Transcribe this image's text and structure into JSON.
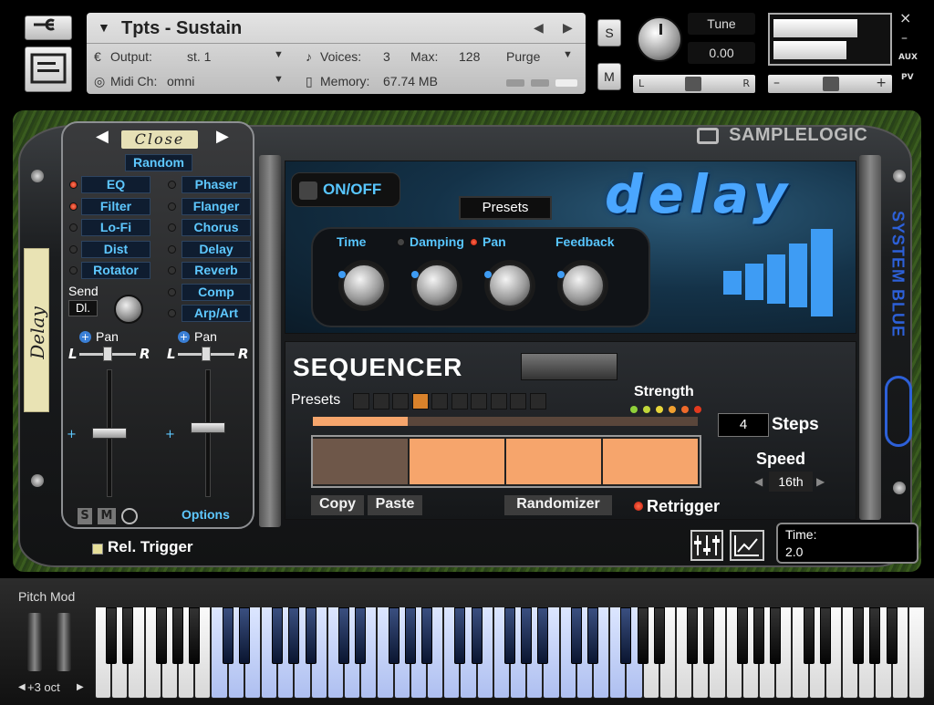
{
  "header": {
    "instrument_name": "Tpts - Sustain",
    "output_label": "Output:",
    "output_value": "st. 1",
    "voices_label": "Voices:",
    "voices_value": "3",
    "max_label": "Max:",
    "max_value": "128",
    "purge_label": "Purge",
    "midi_label": "Midi Ch:",
    "midi_value": "omni",
    "memory_label": "Memory:",
    "memory_value": "67.74 MB",
    "solo_label": "S",
    "mute_label": "M",
    "tune_label": "Tune",
    "tune_value": "0.00",
    "pan_left": "L",
    "pan_right": "R",
    "aux_label": "AUX",
    "pv_label": "PV",
    "close_glyph": "×",
    "minimize_glyph": "–",
    "minus_glyph": "–",
    "plus_glyph": "+"
  },
  "brand": "SAMPLELOGIC",
  "side_label": "Delay",
  "side_brand": "SYSTEM BLUE",
  "fx_panel": {
    "close_label": "Close",
    "random_label": "Random",
    "left_column": [
      {
        "label": "EQ",
        "active": true
      },
      {
        "label": "Filter",
        "active": true
      },
      {
        "label": "Lo-Fi",
        "active": false
      },
      {
        "label": "Dist",
        "active": false
      },
      {
        "label": "Rotator",
        "active": false
      }
    ],
    "right_column": [
      {
        "label": "Phaser",
        "active": false
      },
      {
        "label": "Flanger",
        "active": false
      },
      {
        "label": "Chorus",
        "active": false
      },
      {
        "label": "Delay",
        "active": false
      },
      {
        "label": "Reverb",
        "active": false
      },
      {
        "label": "Comp",
        "active": false
      },
      {
        "label": "Arp/Art",
        "active": false
      }
    ],
    "send_label": "Send",
    "send_value": "Dl.",
    "pan_label": "Pan",
    "pan_l": "L",
    "pan_r": "R",
    "smo_s": "S",
    "smo_m": "M",
    "options_label": "Options"
  },
  "delay": {
    "title": "delay",
    "onoff_label": "ON/OFF",
    "presets_label": "Presets",
    "knobs": [
      {
        "label": "Time",
        "led": false
      },
      {
        "label": "Damping",
        "led": false
      },
      {
        "label": "Pan",
        "led": true
      },
      {
        "label": "Feedback",
        "led": false
      }
    ]
  },
  "sequencer": {
    "title": "SEQUENCER",
    "presets_label": "Presets",
    "preset_slots": 10,
    "active_preset_index": 3,
    "strength_label": "Strength",
    "steps_value": "4",
    "steps_label": "Steps",
    "speed_label": "Speed",
    "speed_value": "16th",
    "step_levels": [
      0,
      1,
      1,
      1
    ],
    "copy_label": "Copy",
    "paste_label": "Paste",
    "randomizer_label": "Randomizer",
    "retrigger_label": "Retrigger"
  },
  "footer": {
    "rel_trigger_label": "Rel. Trigger",
    "time_label": "Time:",
    "time_value": "2.0"
  },
  "keyboard": {
    "pitch_mod_label": "Pitch Mod",
    "octave_label": "+3 oct"
  },
  "colors": {
    "accent_blue": "#58c6ff",
    "led_red": "#e03a1a",
    "step_orange": "#f6a56c",
    "preset_orange": "#d9822b"
  }
}
